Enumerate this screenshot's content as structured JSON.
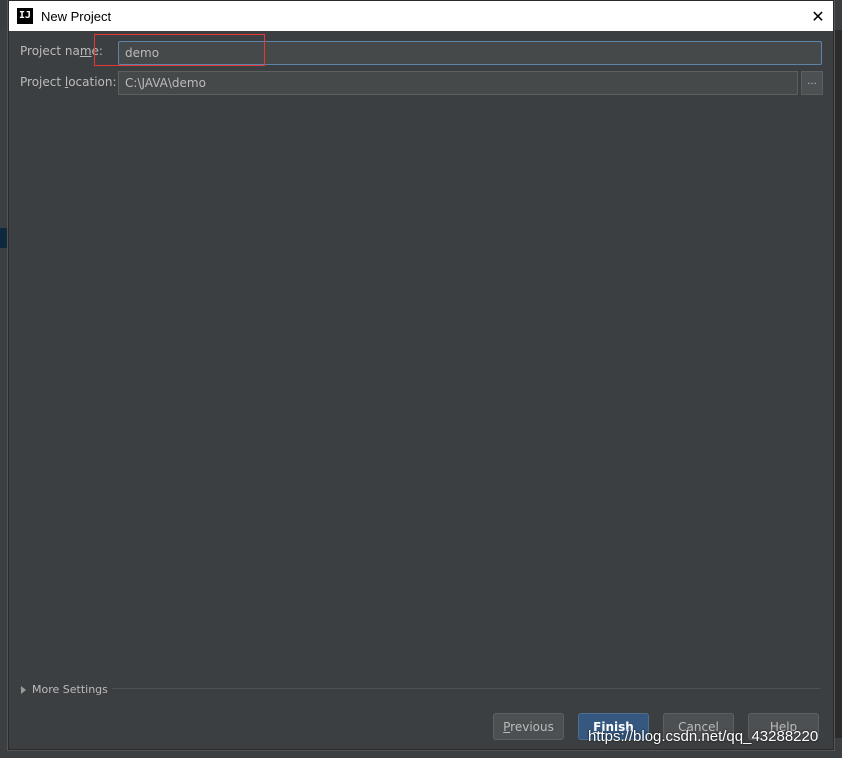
{
  "dialog": {
    "title": "New Project",
    "icon": "intellij-icon",
    "close": "✕"
  },
  "form": {
    "name_label_pre": "Project na",
    "name_label_key": "m",
    "name_label_post": "e:",
    "name_value": "demo",
    "location_label_pre": "Project ",
    "location_label_key": "l",
    "location_label_post": "ocation:",
    "location_value": "C:\\JAVA\\demo",
    "browse_label": "..."
  },
  "more_settings": {
    "label": "More Settings"
  },
  "buttons": {
    "previous_key": "P",
    "previous_rest": "revious",
    "finish_key": "F",
    "finish_rest": "inish",
    "cancel": "Cancel",
    "help": "Help"
  },
  "watermark": "https://blog.csdn.net/qq_43288220",
  "colors": {
    "accent": "#365880",
    "highlight": "#e53935",
    "background": "#3c3f41"
  }
}
